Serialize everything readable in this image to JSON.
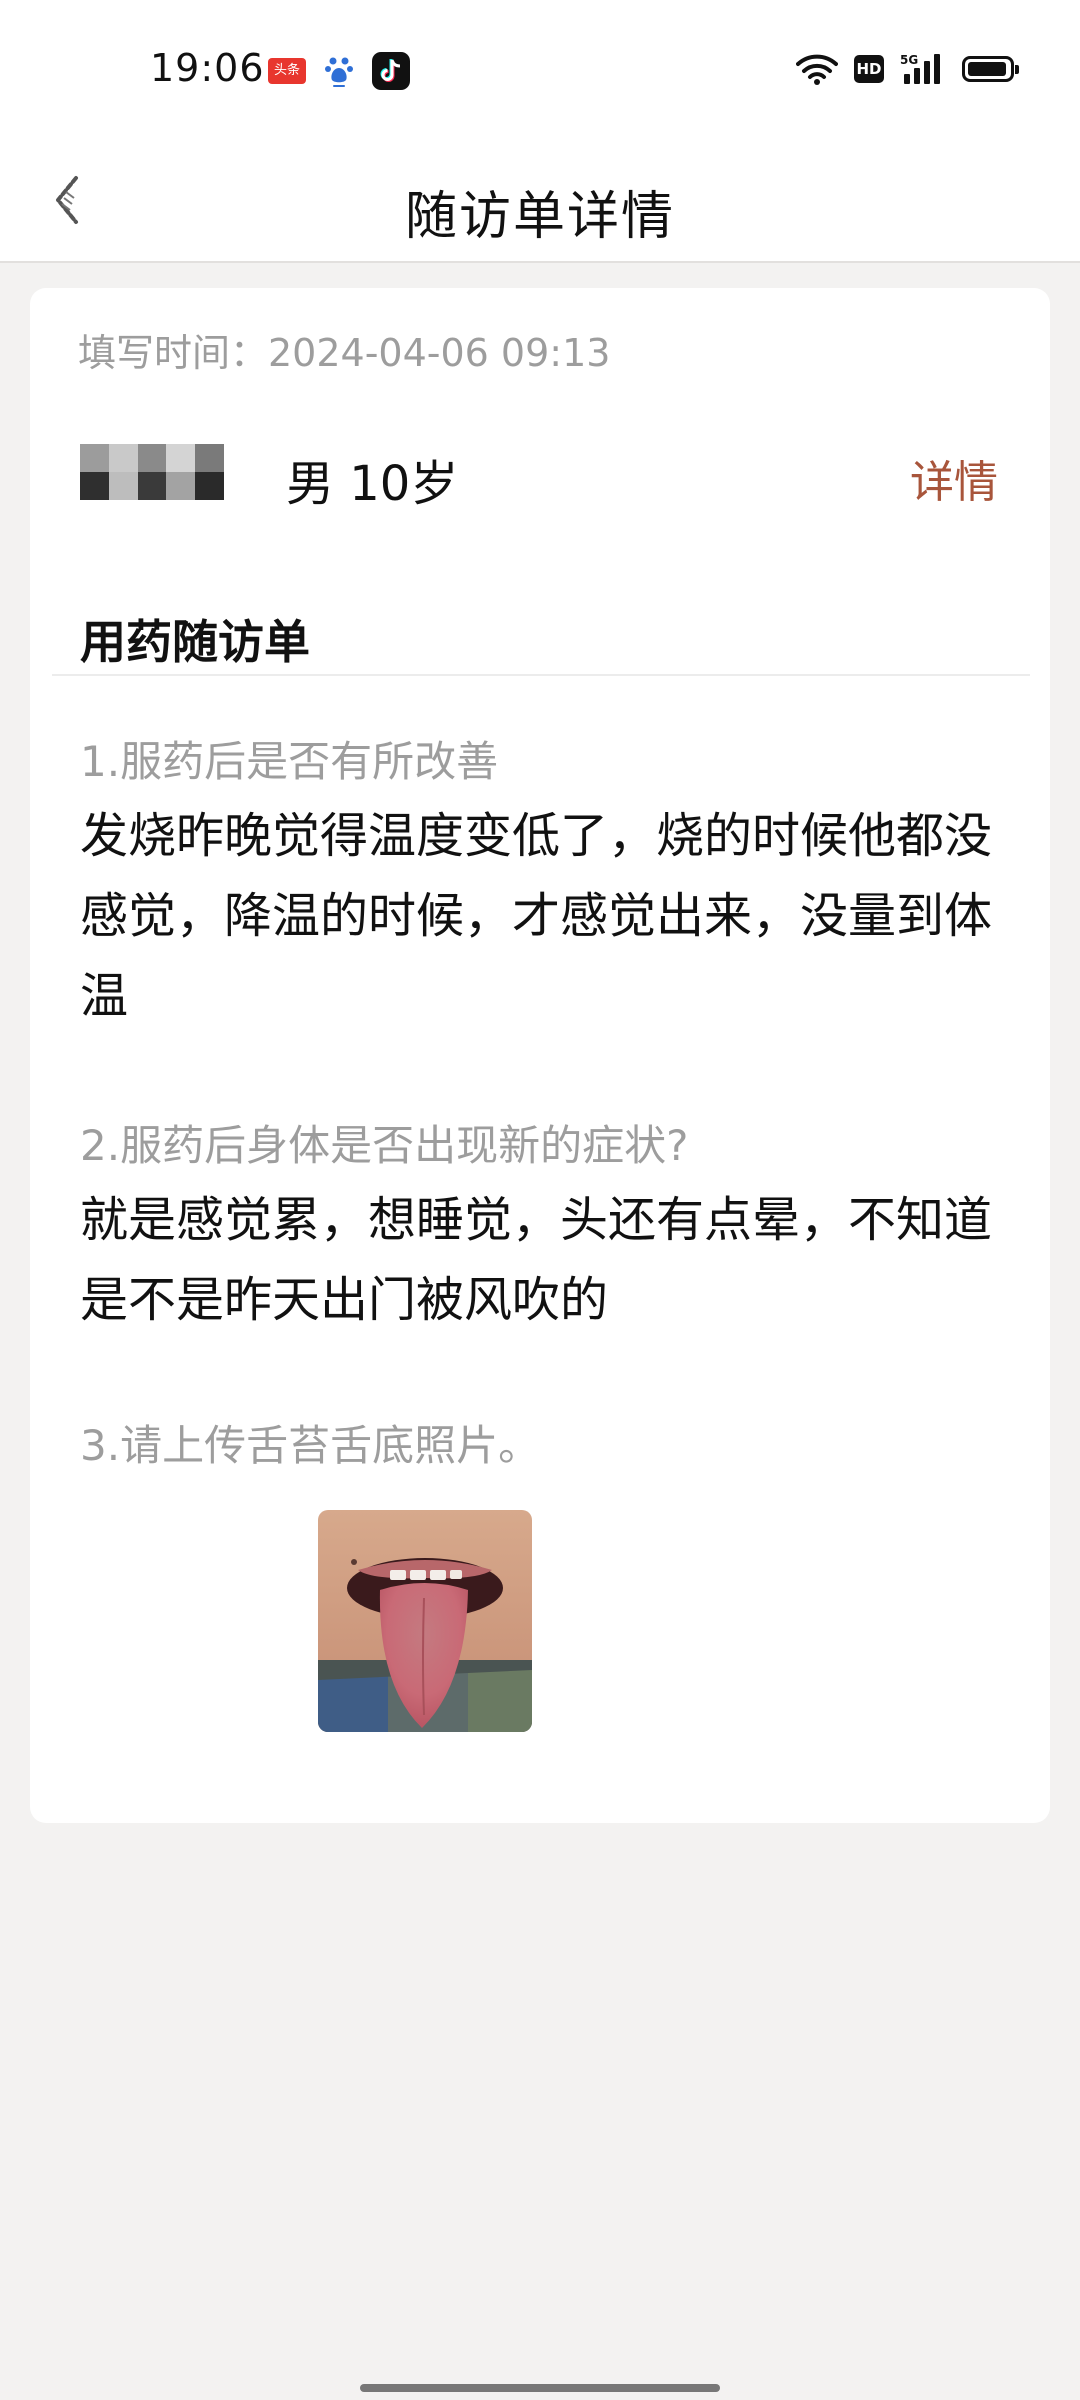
{
  "status_bar": {
    "time": "19:06",
    "app_icons": [
      "toutiao-icon",
      "baidu-icon",
      "douyin-icon"
    ],
    "toutiao_text": "头条",
    "indicators": [
      "wifi-icon",
      "hd-icon",
      "5g-signal-icon",
      "battery-icon"
    ],
    "hd_label": "HD",
    "network_label": "5G"
  },
  "header": {
    "title": "随访单详情",
    "back_icon": "back-arrow-icon"
  },
  "card": {
    "fill_time": "填写时间：2024-04-06 09:13",
    "patient": {
      "info": "男 10岁",
      "detail_link": "详情"
    },
    "form_title": "用药随访单",
    "questions": [
      {
        "question": "1.服药后是否有所改善",
        "answer": "发烧昨晚觉得温度变低了，烧的时候他都没感觉，降温的时候，才感觉出来，没量到体温"
      },
      {
        "question": "2.服药后身体是否出现新的症状?",
        "answer": "就是感觉累，想睡觉，头还有点晕，不知道是不是昨天出门被风吹的"
      },
      {
        "question": "3.请上传舌苔舌底照片。",
        "answer": ""
      }
    ]
  },
  "colors": {
    "accent_link": "#a8553b",
    "muted_text": "#9d9d9d",
    "page_background": "#f3f2f1"
  }
}
